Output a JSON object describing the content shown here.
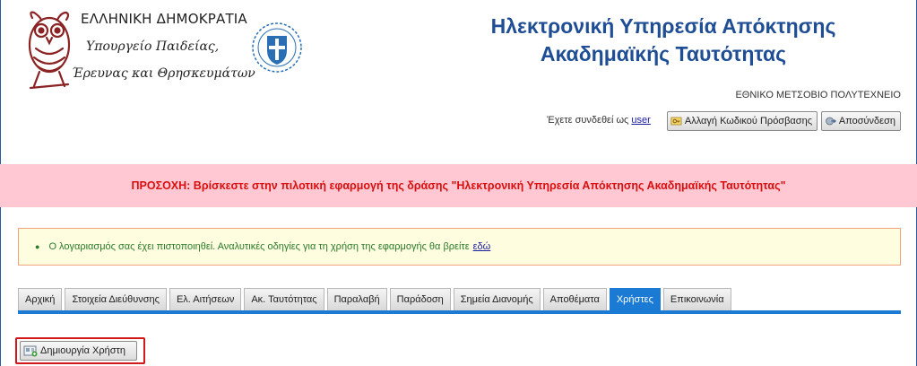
{
  "header": {
    "logo_line1": "ΕΛΛΗΝΙΚΗ ΔΗΜΟΚΡΑΤΙΑ",
    "logo_line2": "Υπουργείο Παιδείας,",
    "logo_line3": "Έρευνας και Θρησκευμάτων",
    "title_line1": "Ηλεκτρονική Υπηρεσία Απόκτησης",
    "title_line2": "Ακαδημαϊκής Ταυτότητας",
    "institution": "ΕΘΝΙΚΟ ΜΕΤΣΟΒΙΟ ΠΟΛΥΤΕΧΝΕΙΟ",
    "logged_in_text": "Έχετε συνδεθεί ως",
    "username": "user",
    "change_password_label": "Αλλαγή Κωδικού Πρόσβασης",
    "logout_label": "Αποσύνδεση"
  },
  "pilot_notice": "ΠΡΟΣΟΧΗ: Βρίσκεστε στην πιλοτική εφαρμογή της δράσης \"Ηλεκτρονική Υπηρεσία Απόκτησης Ακαδημαϊκής Ταυτότητας\"",
  "info": {
    "text": "Ο λογαριασμός σας έχει πιστοποιηθεί. Αναλυτικές οδηγίες για τη χρήση της εφαρμογής θα βρείτε",
    "link_label": "εδώ"
  },
  "tabs": [
    {
      "label": "Αρχική"
    },
    {
      "label": "Στοιχεία Διεύθυνσης"
    },
    {
      "label": "Ελ. Αιτήσεων"
    },
    {
      "label": "Ακ. Ταυτότητας"
    },
    {
      "label": "Παραλαβή"
    },
    {
      "label": "Παράδοση"
    },
    {
      "label": "Σημεία Διανομής"
    },
    {
      "label": "Αποθέματα"
    },
    {
      "label": "Χρήστες",
      "active": true
    },
    {
      "label": "Επικοινωνία"
    }
  ],
  "actions": {
    "create_user_label": "Δημιουργία Χρήστη"
  },
  "colors": {
    "brand_blue": "#1f4e94",
    "tab_active": "#1a7ad4",
    "alert_bg": "#ffc8d2",
    "alert_text": "#d90f0f",
    "info_bg": "#fffde0",
    "info_text": "#2a7a2a",
    "highlight": "#d21818"
  }
}
